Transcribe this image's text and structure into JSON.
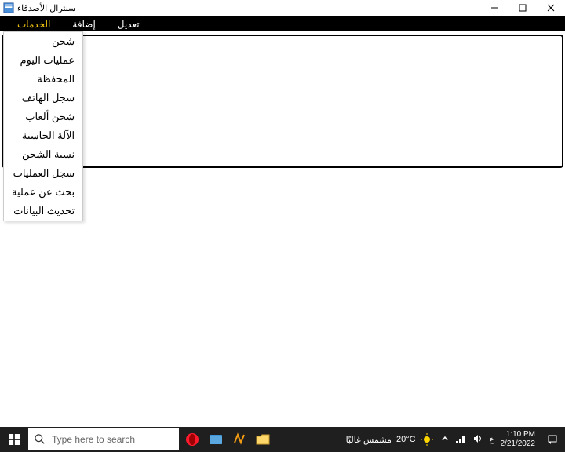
{
  "window": {
    "title": "سنترال الأصدقاء"
  },
  "menubar": {
    "items": [
      {
        "label": "الخدمات"
      },
      {
        "label": "إضافة"
      },
      {
        "label": "تعديل"
      }
    ]
  },
  "dropdown": {
    "items": [
      {
        "label": "شحن"
      },
      {
        "label": "عمليات اليوم"
      },
      {
        "label": "المحفظة"
      },
      {
        "label": "سجل الهاتف"
      },
      {
        "label": "شحن ألعاب"
      },
      {
        "label": "الآلة الحاسبة"
      },
      {
        "label": "نسبة الشحن"
      },
      {
        "label": "سجل العمليات"
      },
      {
        "label": "بحث عن عملية"
      },
      {
        "label": "تحديث البيانات"
      }
    ]
  },
  "taskbar": {
    "search_placeholder": "Type here to search",
    "weather_temp": "20°C",
    "weather_desc": "مشمس غالبًا",
    "time": "1:10 PM",
    "date": "2/21/2022"
  }
}
